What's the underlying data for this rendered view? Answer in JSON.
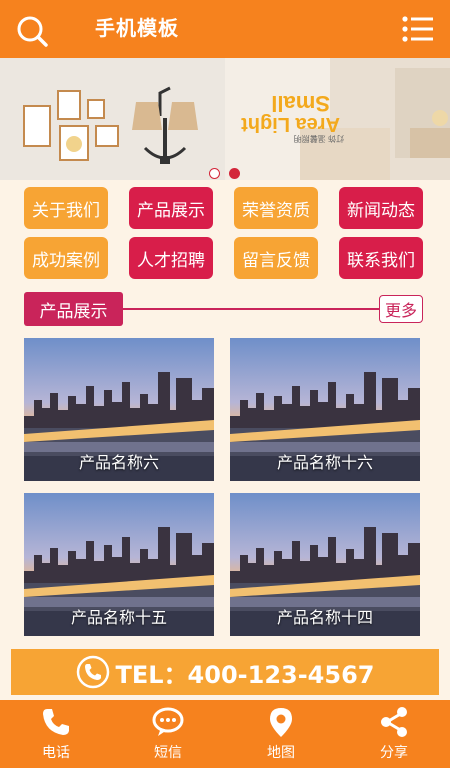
{
  "header": {
    "title": "手机模板"
  },
  "banner": {
    "text_line1": "Small",
    "text_line2": "Area Light",
    "text_small": "灯饰 温馨照明"
  },
  "nav": [
    {
      "label": "关于我们",
      "color": "orange"
    },
    {
      "label": "产品展示",
      "color": "red"
    },
    {
      "label": "荣誉资质",
      "color": "orange"
    },
    {
      "label": "新闻动态",
      "color": "red"
    },
    {
      "label": "成功案例",
      "color": "orange"
    },
    {
      "label": "人才招聘",
      "color": "red"
    },
    {
      "label": "留言反馈",
      "color": "orange"
    },
    {
      "label": "联系我们",
      "color": "red"
    }
  ],
  "section": {
    "title": "产品展示",
    "more": "更多"
  },
  "products": [
    {
      "name": "产品名称六"
    },
    {
      "name": "产品名称十六"
    },
    {
      "name": "产品名称十五"
    },
    {
      "name": "产品名称十四"
    }
  ],
  "tel": {
    "text": "TEL：400-123-4567"
  },
  "footer": [
    {
      "label": "电话",
      "icon": "phone-icon"
    },
    {
      "label": "短信",
      "icon": "message-icon"
    },
    {
      "label": "地图",
      "icon": "map-pin-icon"
    },
    {
      "label": "分享",
      "icon": "share-icon"
    }
  ],
  "colors": {
    "header": "#f6821e",
    "orange": "#f7a434",
    "red": "#d81e4a",
    "accent": "#c9245a"
  }
}
